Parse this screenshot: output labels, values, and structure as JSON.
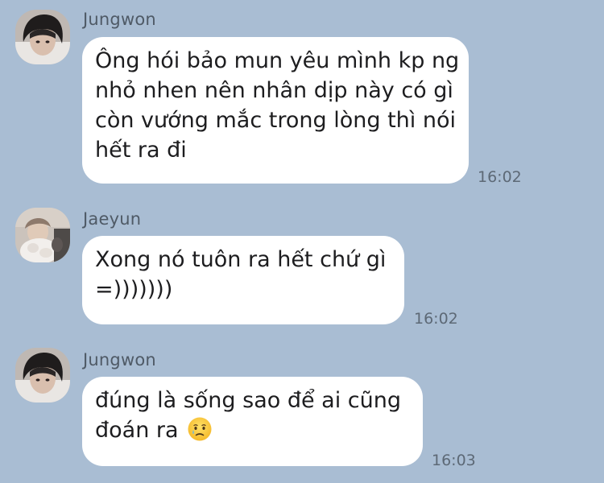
{
  "messages": [
    {
      "sender": "Jungwon",
      "lines": [
        "Ông hói bảo mun yêu mình kp ng",
        "nhỏ nhen nên nhân dịp này có gì",
        "còn vướng mắc trong lòng thì nói",
        "hết ra đi"
      ],
      "time": "16:02"
    },
    {
      "sender": "Jaeyun",
      "lines": [
        "Xong nó tuôn ra hết chứ gì",
        "=)))))))"
      ],
      "time": "16:02"
    },
    {
      "sender": "Jungwon",
      "lines": [
        "đúng là sống sao để ai cũng",
        "đoán ra"
      ],
      "emoji": "crying-face-emoji",
      "time": "16:03"
    }
  ],
  "colors": {
    "background": "#a9bdd3",
    "bubble": "#ffffff",
    "sender_text": "#4f5a66",
    "time_text": "#5d6976"
  }
}
